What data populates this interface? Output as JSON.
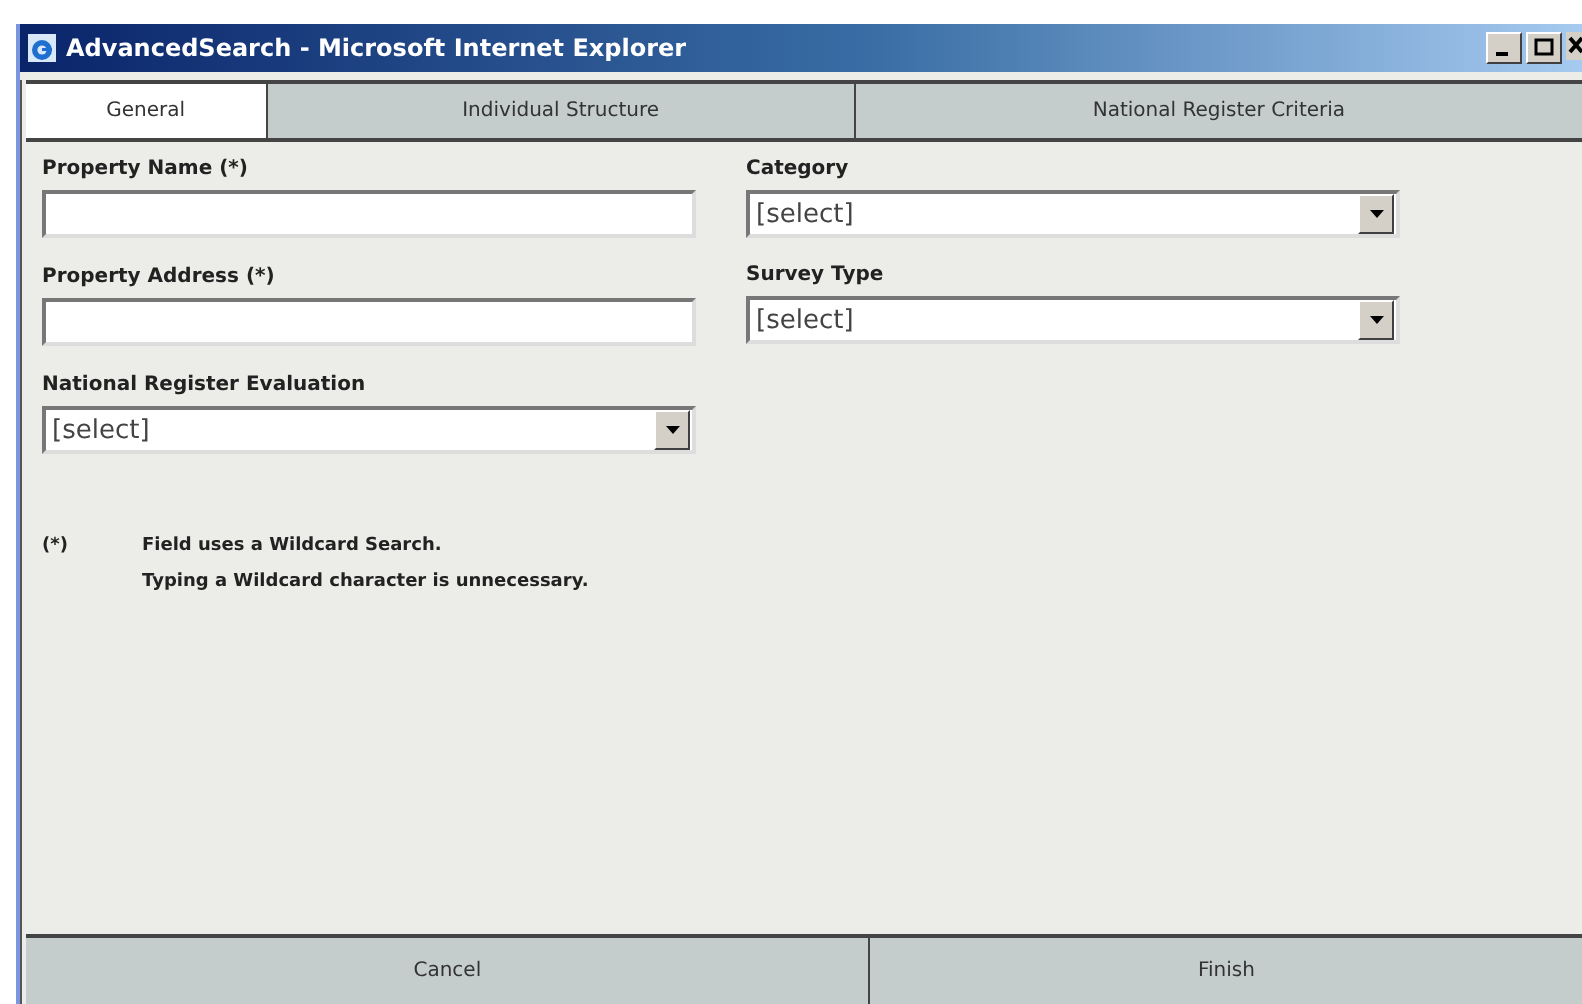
{
  "window": {
    "title": "AdvancedSearch - Microsoft Internet Explorer"
  },
  "tabs": [
    {
      "label": "General",
      "selected": true
    },
    {
      "label": "Individual Structure",
      "selected": false
    },
    {
      "label": "National Register Criteria",
      "selected": false
    }
  ],
  "columns": [
    [
      {
        "kind": "text",
        "label": "Property Name (*)"
      },
      {
        "kind": "text",
        "label": "Property Address (*)"
      },
      {
        "kind": "select",
        "label": "National Register Evaluation",
        "value": "[select]"
      }
    ],
    [
      {
        "kind": "select",
        "label": "Category",
        "value": "[select]"
      },
      {
        "kind": "select",
        "label": "Survey Type",
        "value": "[select]"
      }
    ]
  ],
  "note": {
    "marker": "(*)",
    "lines": [
      "Field uses a Wildcard Search.",
      "Typing a Wildcard character is unnecessary."
    ]
  },
  "buttons": [
    "Cancel",
    "Finish"
  ]
}
